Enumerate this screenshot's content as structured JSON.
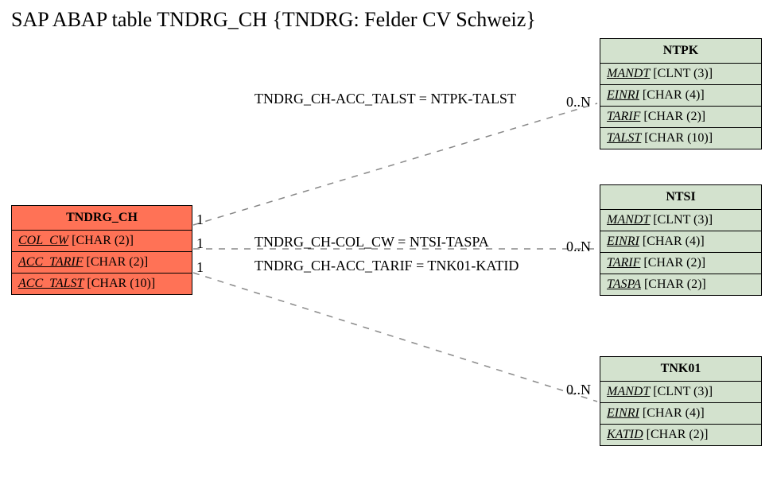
{
  "title": "SAP ABAP table TNDRG_CH {TNDRG: Felder CV Schweiz}",
  "source": {
    "name": "TNDRG_CH",
    "fields": [
      {
        "name": "COL_CW",
        "type": "[CHAR (2)]"
      },
      {
        "name": "ACC_TARIF",
        "type": "[CHAR (2)]"
      },
      {
        "name": "ACC_TALST",
        "type": "[CHAR (10)]"
      }
    ]
  },
  "targets": [
    {
      "name": "NTPK",
      "fields": [
        {
          "name": "MANDT",
          "type": "[CLNT (3)]"
        },
        {
          "name": "EINRI",
          "type": "[CHAR (4)]"
        },
        {
          "name": "TARIF",
          "type": "[CHAR (2)]"
        },
        {
          "name": "TALST",
          "type": "[CHAR (10)]"
        }
      ]
    },
    {
      "name": "NTSI",
      "fields": [
        {
          "name": "MANDT",
          "type": "[CLNT (3)]"
        },
        {
          "name": "EINRI",
          "type": "[CHAR (4)]"
        },
        {
          "name": "TARIF",
          "type": "[CHAR (2)]"
        },
        {
          "name": "TASPA",
          "type": "[CHAR (2)]"
        }
      ]
    },
    {
      "name": "TNK01",
      "fields": [
        {
          "name": "MANDT",
          "type": "[CLNT (3)]"
        },
        {
          "name": "EINRI",
          "type": "[CHAR (4)]"
        },
        {
          "name": "KATID",
          "type": "[CHAR (2)]"
        }
      ]
    }
  ],
  "relations": [
    {
      "label": "TNDRG_CH-ACC_TALST = NTPK-TALST",
      "src_card": "1",
      "tgt_card": "0..N"
    },
    {
      "label": "TNDRG_CH-COL_CW = NTSI-TASPA",
      "src_card": "1",
      "tgt_card": "0..N"
    },
    {
      "label": "TNDRG_CH-ACC_TARIF = TNK01-KATID",
      "src_card": "1",
      "tgt_card": "0..N"
    }
  ]
}
